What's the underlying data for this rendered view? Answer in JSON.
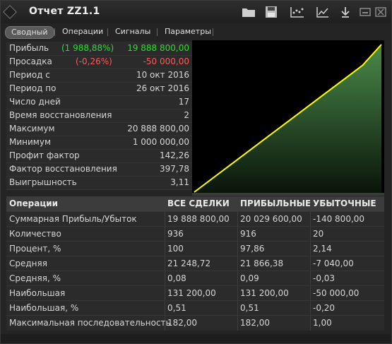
{
  "window": {
    "title": "Отчет ZZ1.1"
  },
  "toolbar": {
    "icons": [
      "folder-icon",
      "save-icon",
      "chart-settings-icon",
      "line-chart-icon",
      "download-icon",
      "minimize-icon",
      "close-icon"
    ]
  },
  "tabs": [
    "Сводный",
    "Операции",
    "Сигналы",
    "Параметры"
  ],
  "active_tab": "Сводный",
  "summary": {
    "profit": {
      "label": "Прибыль",
      "percent": "(1 988,88%)",
      "value": "19 888 800,00"
    },
    "drawdown": {
      "label": "Просадка",
      "percent": "(-0,26%)",
      "value": "-50 000,00"
    },
    "rows": [
      {
        "label": "Период с",
        "value": "10 окт 2016"
      },
      {
        "label": "Период по",
        "value": "26 окт 2016"
      },
      {
        "label": "Число дней",
        "value": "17"
      },
      {
        "label": "Время восстановления",
        "value": "2"
      },
      {
        "label": "Максимум",
        "value": "20 888 800,00"
      },
      {
        "label": "Минимум",
        "value": "1 000 000,00"
      },
      {
        "label": "Профит фактор",
        "value": "142,26"
      },
      {
        "label": "Фактор восстановления",
        "value": "397,78"
      },
      {
        "label": "Выигрышность",
        "value": "3,11"
      }
    ]
  },
  "colors": {
    "profit": "#2fdc2f",
    "loss": "#ff5a5a",
    "equity_line": "#ffff00",
    "equity_fill": "#3e7a3e"
  },
  "chart_data": {
    "type": "area",
    "x": [
      0,
      0.1,
      0.2,
      0.3,
      0.4,
      0.5,
      0.6,
      0.7,
      0.8,
      0.9,
      1
    ],
    "series": [
      {
        "values": [
          1000000,
          2900000,
          4800000,
          6700000,
          8600000,
          10500000,
          12400000,
          14300000,
          16200000,
          18100000,
          20888800
        ]
      }
    ],
    "ylim": [
      1000000,
      20888800
    ],
    "grid": false
  },
  "stats": {
    "headers": [
      "Операции",
      "ВСЕ СДЕЛКИ",
      "ПРИБЫЛЬНЫЕ",
      "УБЫТОЧНЫЕ"
    ],
    "rows": [
      [
        "Суммарная Прибыль/Убыток",
        "19 888 800,00",
        "20 029 600,00",
        "-140 800,00"
      ],
      [
        "Количество",
        "936",
        "916",
        "20"
      ],
      [
        "Процент, %",
        "100",
        "97,86",
        "2,14"
      ],
      [
        "Средняя",
        "21 248,72",
        "21 866,38",
        "-7 040,00"
      ],
      [
        "Средняя, %",
        "0,08",
        "0,09",
        "-0,03"
      ],
      [
        "Наибольшая",
        "131 200,00",
        "131 200,00",
        "-50 000,00"
      ],
      [
        "Наибольшая, %",
        "0,51",
        "0,51",
        "-0,20"
      ],
      [
        "Максимальная последовательность",
        "182,00",
        "182,00",
        "1,00"
      ]
    ]
  }
}
